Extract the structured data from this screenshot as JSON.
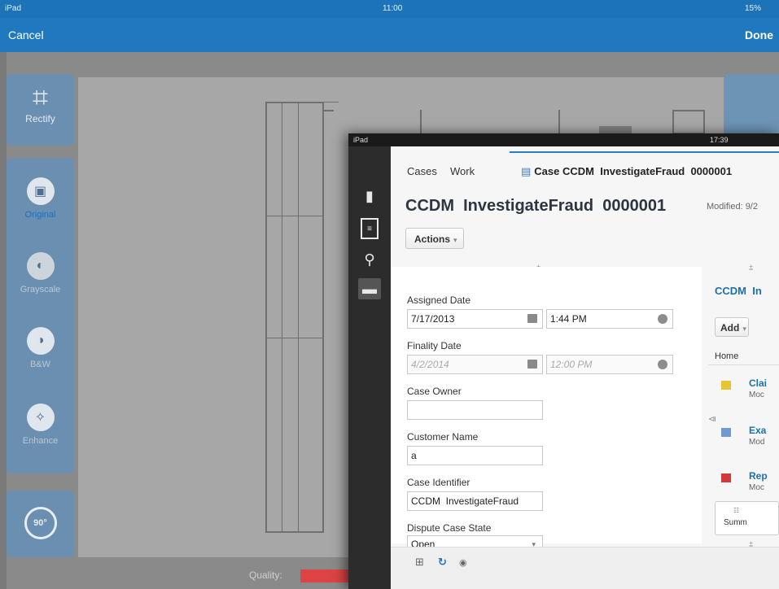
{
  "back": {
    "status": {
      "carrier": "iPad",
      "time": "11:00",
      "battery": "15%"
    },
    "nav": {
      "cancel_label": "Cancel",
      "done_label": "Done"
    },
    "tools": [
      {
        "label": "Rectify",
        "icon": "crop-icon"
      },
      {
        "label": "Original",
        "icon": "image-icon"
      },
      {
        "label": "Grayscale",
        "icon": "grayscale-icon"
      },
      {
        "label": "B&W",
        "icon": "contrast-icon"
      },
      {
        "label": "Enhance",
        "icon": "wand-icon"
      },
      {
        "label": "",
        "icon": "rotate-90-icon"
      }
    ],
    "rotate_label": "90°",
    "quality_label": "Quality:",
    "colors": {
      "nav": "#2078be",
      "panel": "#6a8fb0",
      "quality_bar": "#dd4444"
    }
  },
  "front": {
    "status": {
      "carrier": "iPad",
      "time": "17:39"
    },
    "tabs": [
      {
        "label": "Cases"
      },
      {
        "label": "Work"
      },
      {
        "label": "Case CCDM  InvestigateFraud  0000001"
      }
    ],
    "title": "CCDM  InvestigateFraud  0000001",
    "modified": "Modified: 9/2",
    "actions_label": "Actions",
    "form": {
      "assigned_date_label": "Assigned Date",
      "assigned_date": "7/17/2013",
      "assigned_time": "1:44 PM",
      "finality_date_label": "Finality Date",
      "finality_date": "4/2/2014",
      "finality_time": "12:00 PM",
      "case_owner_label": "Case Owner",
      "case_owner": "",
      "customer_name_label": "Customer Name",
      "customer_name": "a",
      "case_identifier_label": "Case Identifier",
      "case_identifier": "CCDM  InvestigateFraud",
      "dispute_state_label": "Dispute Case State",
      "dispute_state": "Open"
    },
    "right": {
      "title": "CCDM  In",
      "add_label": "Add",
      "home_label": "Home",
      "items": [
        {
          "title": "Clai",
          "sub": "Moc",
          "icon": "folder-icon"
        },
        {
          "title": "Exa",
          "sub": "Mod",
          "icon": "doc-icon"
        },
        {
          "title": "Rep",
          "sub": "Moc",
          "icon": "pdf-icon"
        }
      ],
      "summary_label": "Summ"
    }
  }
}
